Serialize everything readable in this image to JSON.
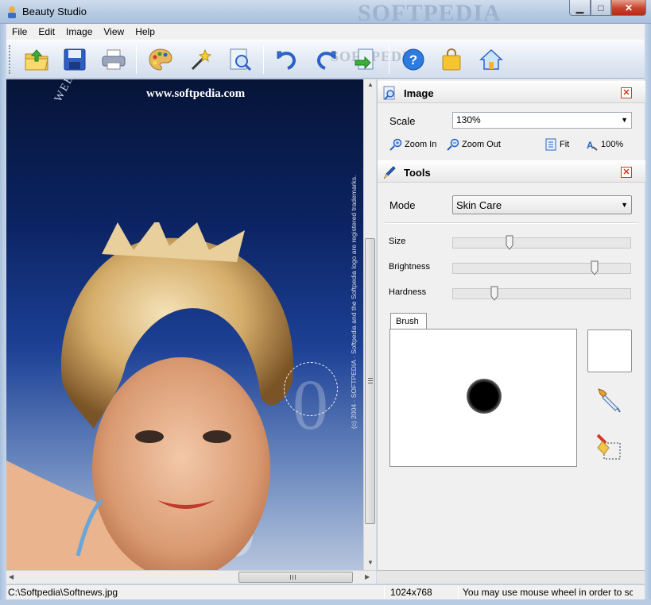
{
  "window": {
    "title": "Beauty Studio",
    "watermark": "SOFTPEDIA",
    "controls": [
      "minimize",
      "maximize",
      "close"
    ]
  },
  "menu": [
    "File",
    "Edit",
    "Image",
    "View",
    "Help"
  ],
  "toolbar": {
    "watermark": "SOFTPEDIA",
    "buttons": [
      "open-icon",
      "save-icon",
      "print-icon",
      "palette-icon",
      "magic-wand-icon",
      "preview-icon",
      "undo-icon",
      "redo-icon",
      "export-icon",
      "help-icon",
      "shop-bag-icon",
      "home-icon"
    ]
  },
  "image": {
    "site_url": "www.softpedia.com",
    "arc_text": "WEB ENT",
    "side_copyright": "(c) 2004 · SOFTPEDIA · Softpedia and the Softpedia logo are registered trademarks."
  },
  "image_panel": {
    "title": "Image",
    "scale_label": "Scale",
    "scale_value": "130%",
    "zoom_in": "Zoom In",
    "zoom_out": "Zoom Out",
    "fit": "Fit",
    "actual": "100%"
  },
  "tools_panel": {
    "title": "Tools",
    "mode_label": "Mode",
    "mode_value": "Skin Care",
    "sliders": [
      {
        "label": "Size",
        "value": 0.31
      },
      {
        "label": "Brightness",
        "value": 0.81
      },
      {
        "label": "Hardness",
        "value": 0.22
      }
    ],
    "brush_tab": "Brush"
  },
  "status": {
    "path": "C:\\Softpedia\\Softnews.jpg",
    "dimensions": "1024x768",
    "hint": "You may use mouse wheel in order to sc"
  },
  "colors": {
    "accent_close": "#d23a22",
    "frame": "#b7cbe3"
  }
}
